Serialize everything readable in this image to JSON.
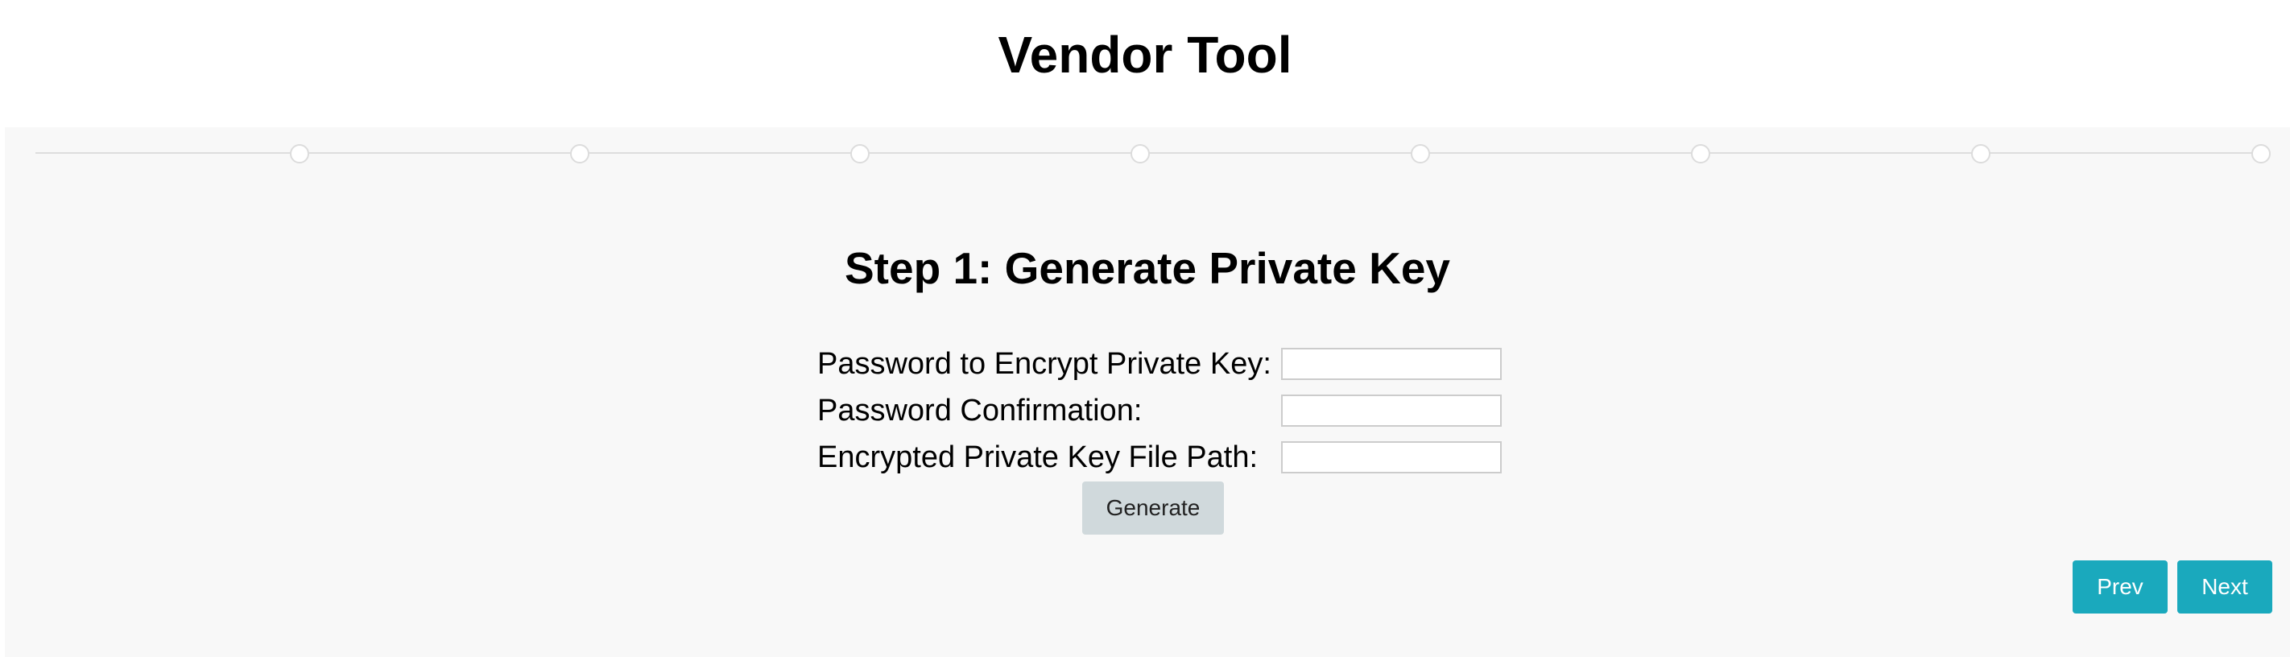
{
  "app": {
    "title": "Vendor Tool"
  },
  "wizard": {
    "step_count": 9,
    "current_step": 1
  },
  "step": {
    "title": "Step 1: Generate Private Key"
  },
  "form": {
    "fields": [
      {
        "label": "Password to Encrypt Private Key:",
        "value": ""
      },
      {
        "label": "Password Confirmation:",
        "value": ""
      },
      {
        "label": "Encrypted Private Key File Path:",
        "value": ""
      }
    ],
    "generate_label": "Generate"
  },
  "navigation": {
    "prev_label": "Prev",
    "next_label": "Next"
  },
  "colors": {
    "panel_background": "#f8f8f8",
    "nav_button": "#1aa9bd",
    "generate_button": "#d0d9dc"
  }
}
